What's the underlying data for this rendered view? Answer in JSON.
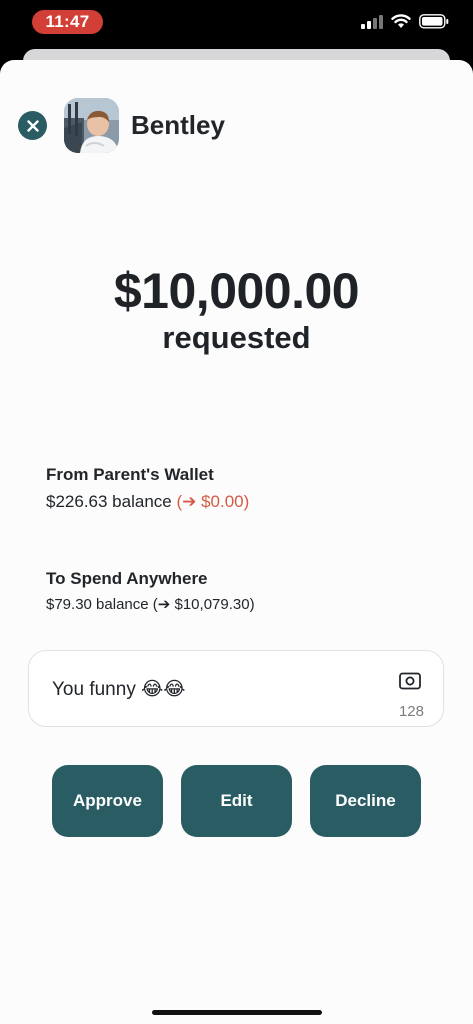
{
  "status": {
    "time": "11:47",
    "icons": [
      "cellular-signal-icon",
      "wifi-icon",
      "battery-icon"
    ],
    "time_pill_color": "#d23f36"
  },
  "header": {
    "close_icon": "close-icon",
    "name": "Bentley"
  },
  "request": {
    "amount": "$10,000.00",
    "label": "requested"
  },
  "from": {
    "title": "From Parent's Wallet",
    "balance": "$226.63 balance",
    "projection": "(➔ $0.00)"
  },
  "to": {
    "title": "To Spend Anywhere",
    "balance": "$79.30 balance",
    "projection": "(➔ $10,079.30)"
  },
  "memo": {
    "text": "You funny 😂😂",
    "char_count": "128",
    "icon": "photo-icon"
  },
  "actions": {
    "approve": "Approve",
    "edit": "Edit",
    "decline": "Decline"
  },
  "colors": {
    "accent": "#2a5d63",
    "negative": "#d35b45",
    "text": "#22262b"
  }
}
